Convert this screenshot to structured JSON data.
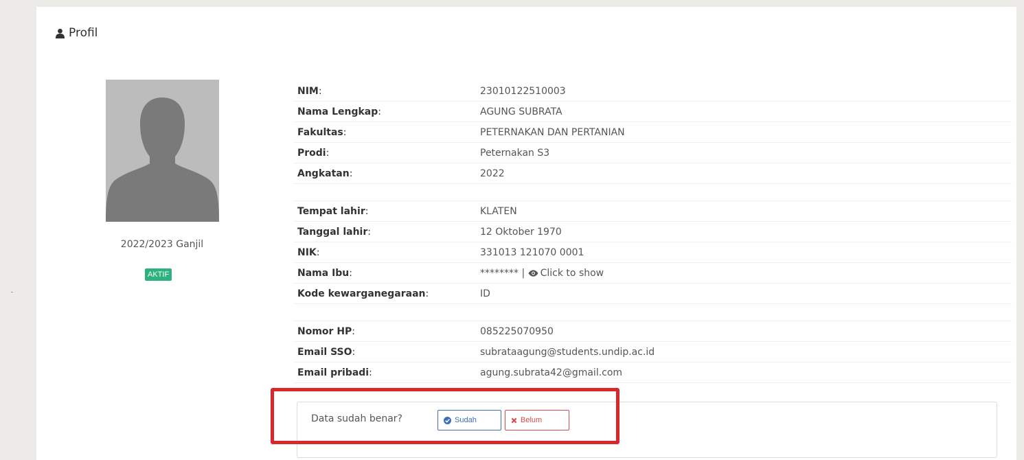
{
  "panel": {
    "title": "Profil",
    "icon": "user-icon"
  },
  "profile": {
    "semester": "2022/2023 Ganjil",
    "status": "AKTIF",
    "status_color": "#2db27f"
  },
  "rows": [
    {
      "label": "NIM",
      "value": "23010122510003"
    },
    {
      "label": "Nama Lengkap",
      "value": "AGUNG SUBRATA"
    },
    {
      "label": "Fakultas",
      "value": "PETERNAKAN DAN PERTANIAN"
    },
    {
      "label": "Prodi",
      "value": "Peternakan S3"
    },
    {
      "label": "Angkatan",
      "value": "2022"
    },
    {
      "label": "Tempat lahir",
      "value": "KLATEN"
    },
    {
      "label": "Tanggal lahir",
      "value": "12 Oktober 1970"
    },
    {
      "label": "NIK",
      "value": "331013 121070 0001"
    },
    {
      "label": "Nama Ibu",
      "value": "******** | ",
      "link": "Click to show"
    },
    {
      "label": "Kode kewarganegaraan",
      "value": "ID"
    },
    {
      "label": "Nomor HP",
      "value": "085225070950"
    },
    {
      "label": "Email SSO",
      "value": "subrataagung@students.undip.ac.id"
    },
    {
      "label": "Email pribadi",
      "value": "agung.subrata42@gmail.com"
    }
  ],
  "confirm": {
    "question": "Data sudah benar?",
    "yes_label": "Sudah",
    "no_label": "Belum",
    "yes_color": "#3b6fb7",
    "no_color": "#d84a4a",
    "highlight_color": "#d9272e"
  }
}
